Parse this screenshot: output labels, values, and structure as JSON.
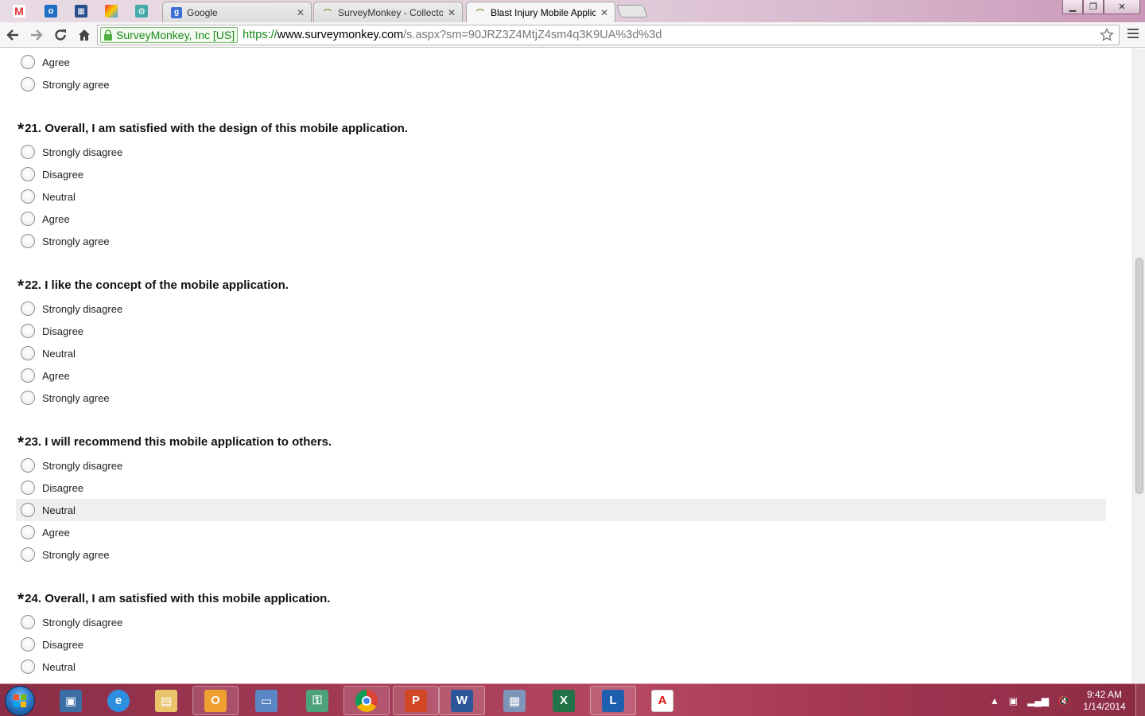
{
  "browser": {
    "tabs": [
      {
        "label": "Google",
        "favicon": "google-search"
      },
      {
        "label": "SurveyMonkey - Collector",
        "favicon": "surveymonkey"
      },
      {
        "label": "Blast Injury Mobile Applic",
        "favicon": "surveymonkey",
        "active": true
      }
    ],
    "url": {
      "ev_label": "SurveyMonkey, Inc [US]",
      "scheme": "https://",
      "host": "www.surveymonkey.com",
      "path": "/s.aspx?sm=90JRZ3Z4MtjZ4sm4q3K9UA%3d%3d"
    }
  },
  "survey": {
    "prev_options": [
      "Agree",
      "Strongly agree"
    ],
    "questions": [
      {
        "title": "21. Overall, I am satisfied with the design of this mobile application.",
        "options": [
          "Strongly disagree",
          "Disagree",
          "Neutral",
          "Agree",
          "Strongly agree"
        ]
      },
      {
        "title": "22. I like the concept of the mobile application.",
        "options": [
          "Strongly disagree",
          "Disagree",
          "Neutral",
          "Agree",
          "Strongly agree"
        ]
      },
      {
        "title": "23. I will recommend this mobile application to others.",
        "options": [
          "Strongly disagree",
          "Disagree",
          "Neutral",
          "Agree",
          "Strongly agree"
        ]
      },
      {
        "title": "24. Overall, I am satisfied with this mobile application.",
        "options": [
          "Strongly disagree",
          "Disagree",
          "Neutral"
        ]
      }
    ],
    "required_marker": "*"
  },
  "taskbar": {
    "clock_time": "9:42 AM",
    "clock_date": "1/14/2014"
  },
  "colors": {
    "secure_green": "#1a8a1a",
    "hover_row": "#efefee",
    "taskbar": "#a23955"
  }
}
